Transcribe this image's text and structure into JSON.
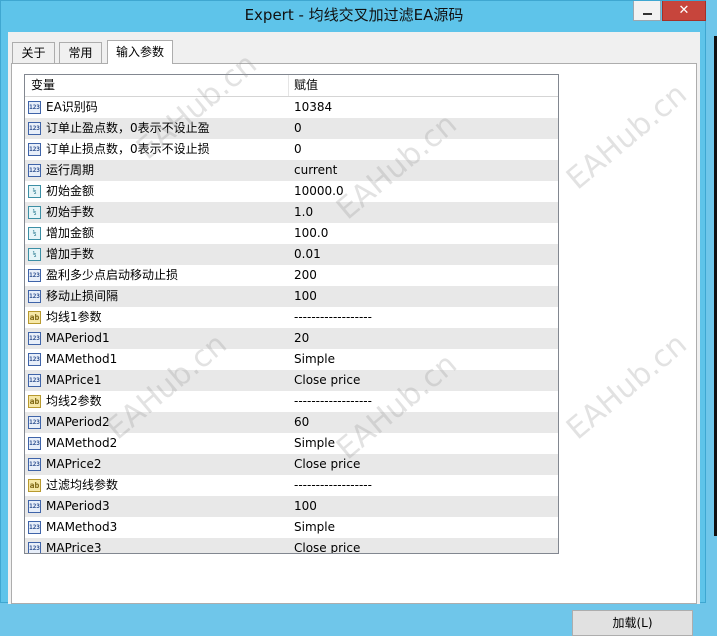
{
  "window": {
    "title": "Expert - 均线交叉加过滤EA源码",
    "close_glyph": "✕"
  },
  "tabs": [
    {
      "label": "关于"
    },
    {
      "label": "常用"
    },
    {
      "label": "输入参数"
    }
  ],
  "table": {
    "headers": {
      "variable": "变量",
      "value": "赋值"
    },
    "rows": [
      {
        "name": "EA识别码",
        "value": "10384",
        "type_icon": "int",
        "icon_text": "123"
      },
      {
        "name": "订单止盈点数，0表示不设止盈",
        "value": "0",
        "type_icon": "int",
        "icon_text": "123"
      },
      {
        "name": "订单止损点数，0表示不设止损",
        "value": "0",
        "type_icon": "int",
        "icon_text": "123"
      },
      {
        "name": "运行周期",
        "value": "current",
        "type_icon": "int",
        "icon_text": "123"
      },
      {
        "name": "初始金额",
        "value": "10000.0",
        "type_icon": "double",
        "icon_text": "½"
      },
      {
        "name": "初始手数",
        "value": "1.0",
        "type_icon": "double",
        "icon_text": "½"
      },
      {
        "name": "增加金额",
        "value": "100.0",
        "type_icon": "double",
        "icon_text": "½"
      },
      {
        "name": "增加手数",
        "value": "0.01",
        "type_icon": "double",
        "icon_text": "½"
      },
      {
        "name": "盈利多少点启动移动止损",
        "value": "200",
        "type_icon": "int",
        "icon_text": "123"
      },
      {
        "name": "移动止损间隔",
        "value": "100",
        "type_icon": "int",
        "icon_text": "123"
      },
      {
        "name": "均线1参数",
        "value": "------------------",
        "type_icon": "string",
        "icon_text": "ab"
      },
      {
        "name": "MAPeriod1",
        "value": "20",
        "type_icon": "int",
        "icon_text": "123"
      },
      {
        "name": "MAMethod1",
        "value": "Simple",
        "type_icon": "int",
        "icon_text": "123"
      },
      {
        "name": "MAPrice1",
        "value": "Close price",
        "type_icon": "int",
        "icon_text": "123"
      },
      {
        "name": "均线2参数",
        "value": "------------------",
        "type_icon": "string",
        "icon_text": "ab"
      },
      {
        "name": "MAPeriod2",
        "value": "60",
        "type_icon": "int",
        "icon_text": "123"
      },
      {
        "name": "MAMethod2",
        "value": "Simple",
        "type_icon": "int",
        "icon_text": "123"
      },
      {
        "name": "MAPrice2",
        "value": "Close price",
        "type_icon": "int",
        "icon_text": "123"
      },
      {
        "name": "过滤均线参数",
        "value": "------------------",
        "type_icon": "string",
        "icon_text": "ab"
      },
      {
        "name": "MAPeriod3",
        "value": "100",
        "type_icon": "int",
        "icon_text": "123"
      },
      {
        "name": "MAMethod3",
        "value": "Simple",
        "type_icon": "int",
        "icon_text": "123"
      },
      {
        "name": "MAPrice3",
        "value": "Close price",
        "type_icon": "int",
        "icon_text": "123"
      }
    ]
  },
  "buttons": {
    "load": "加载(L)"
  },
  "watermark": {
    "text": "EAHub.cn"
  },
  "colors": {
    "title_bar": "#5ec4ea",
    "close_button": "#c7453c",
    "row_alt": "#e8e8e8"
  }
}
